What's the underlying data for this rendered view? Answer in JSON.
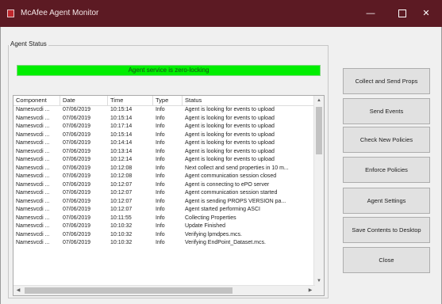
{
  "window": {
    "title": "McAfee Agent Monitor",
    "minimize_glyph": "—",
    "close_glyph": "✕",
    "icon": "mcafee-shield-icon"
  },
  "group": {
    "label": "Agent Status"
  },
  "status_bar": {
    "text": "Agent service is zero-locking",
    "color": "#00ee00"
  },
  "table": {
    "columns": [
      "Component",
      "Date",
      "Time",
      "Type",
      "Status"
    ],
    "rows": [
      [
        "Namesvcdi ...",
        "07/06/2019",
        "10:15:14",
        "Info",
        "Agent is looking for events to upload"
      ],
      [
        "Namesvcdi ...",
        "07/06/2019",
        "10:15:14",
        "Info",
        "Agent is looking for events to upload"
      ],
      [
        "Namesvcdi ...",
        "07/06/2019",
        "10:17:14",
        "Info",
        "Agent is looking for events to upload"
      ],
      [
        "Namesvcdi ...",
        "07/06/2019",
        "10:15:14",
        "Info",
        "Agent is looking for events to upload"
      ],
      [
        "Namesvcdi ...",
        "07/06/2019",
        "10:14:14",
        "Info",
        "Agent is looking for events to upload"
      ],
      [
        "Namesvcdi ...",
        "07/06/2019",
        "10:13:14",
        "Info",
        "Agent is looking for events to upload"
      ],
      [
        "Namesvcdi ...",
        "07/06/2019",
        "10:12:14",
        "Info",
        "Agent is looking for events to upload"
      ],
      [
        "Namesvcdi ...",
        "07/06/2019",
        "10:12:08",
        "Info",
        "Next collect and send properties in 10 m..."
      ],
      [
        "Namesvcdi ...",
        "07/06/2019",
        "10:12:08",
        "Info",
        "Agent communication session closed"
      ],
      [
        "Namesvcdi ...",
        "07/06/2019",
        "10:12:07",
        "Info",
        "Agent is connecting to ePO server"
      ],
      [
        "Namesvcdi ...",
        "07/06/2019",
        "10:12:07",
        "Info",
        "Agent communication session started"
      ],
      [
        "Namesvcdi ...",
        "07/06/2019",
        "10:12:07",
        "Info",
        "Agent is sending PROPS VERSION pa..."
      ],
      [
        "Namesvcdi ...",
        "07/06/2019",
        "10:12:07",
        "Info",
        "Agent started performing ASCI"
      ],
      [
        "Namesvcdi ...",
        "07/06/2019",
        "10:11:55",
        "Info",
        "Collecting Properties"
      ],
      [
        "Namesvcdi ...",
        "07/06/2019",
        "10:10:32",
        "Info",
        "Update Finished"
      ],
      [
        "Namesvcdi ...",
        "07/06/2019",
        "10:10:32",
        "Info",
        "Verifying lpmdpes.mcs."
      ],
      [
        "Namesvcdi ...",
        "07/06/2019",
        "10:10:32",
        "Info",
        "Verifying EndPoint_Dataset.mcs."
      ]
    ]
  },
  "scrollbars": {
    "up": "▲",
    "down": "▼",
    "left": "◀",
    "right": "▶"
  },
  "buttons": {
    "collect_send_props": "Collect and Send Props",
    "send_events": "Send Events",
    "check_new_policies": "Check New Policies",
    "enforce_policies": "Enforce Policies",
    "agent_settings": "Agent Settings",
    "save_contents": "Save Contents to Desktop",
    "close": "Close"
  }
}
